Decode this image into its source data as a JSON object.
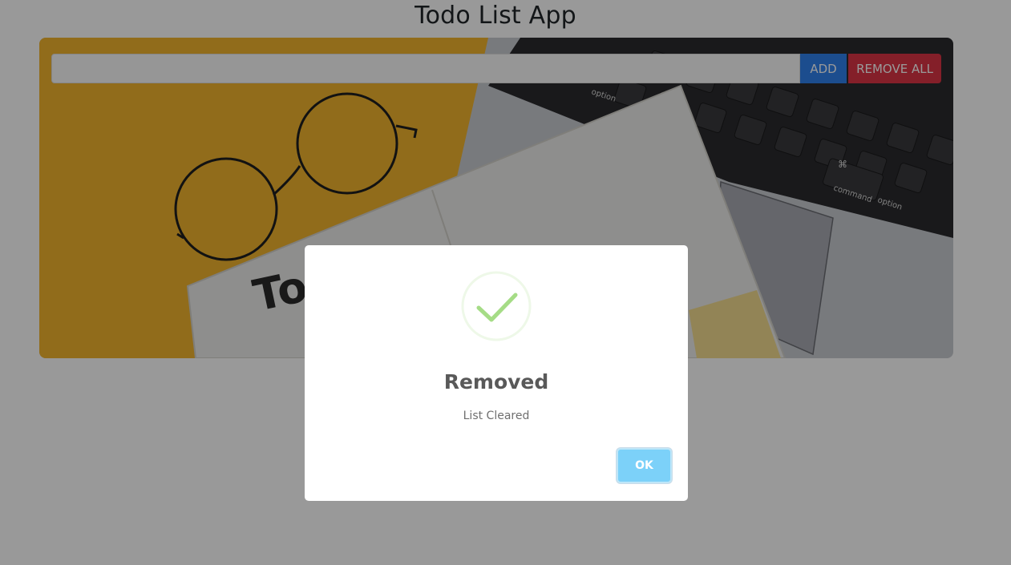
{
  "app": {
    "title": "Todo List App"
  },
  "form": {
    "input_value": "",
    "input_placeholder": "",
    "add_label": "ADD",
    "remove_all_label": "REMOVE ALL"
  },
  "hero": {
    "notebook_text": "To",
    "keyboard_labels": {
      "option_left": "option",
      "command": "command",
      "option_right": "option",
      "command_symbol": "⌘"
    }
  },
  "modal": {
    "icon": "success-check-icon",
    "title": "Removed",
    "text": "List Cleared",
    "ok_label": "OK"
  },
  "colors": {
    "add_button": "#2f80ed",
    "remove_all_button": "#dc3545",
    "ok_button": "#7cd1f9",
    "success_check": "#a5dc86",
    "overlay": "rgba(0,0,0,0.4)"
  }
}
